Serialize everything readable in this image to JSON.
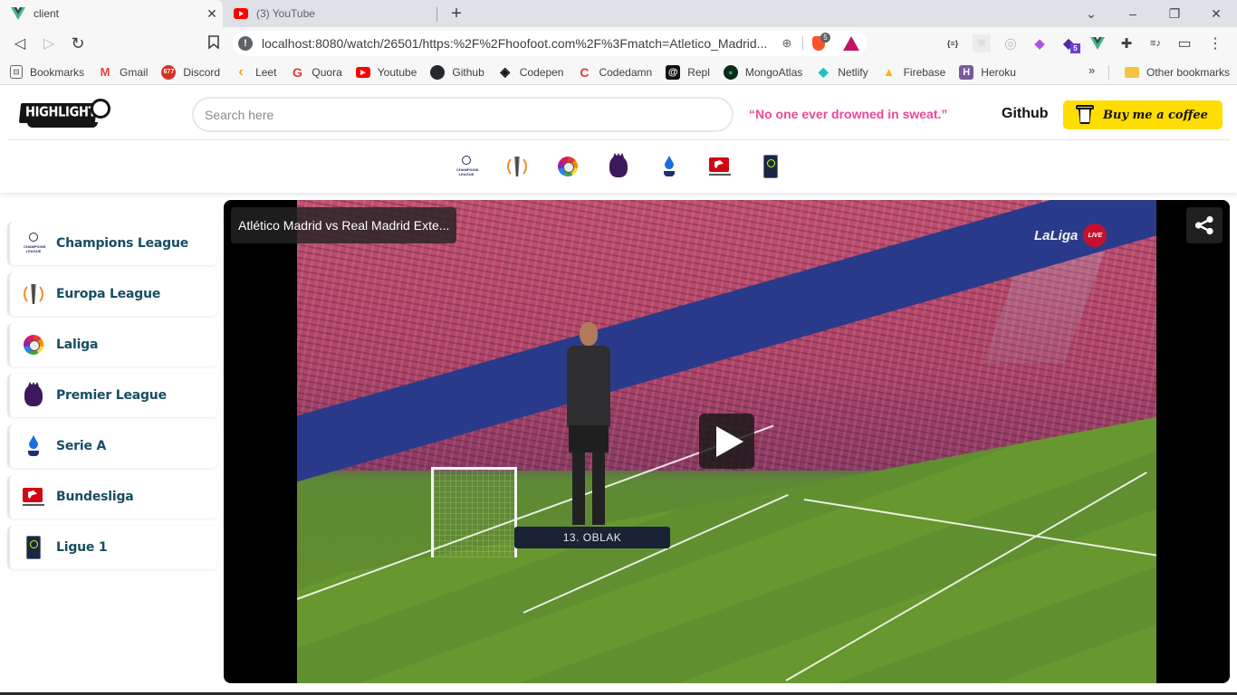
{
  "browser": {
    "tabs": [
      {
        "title": "client",
        "icon": "vue-icon",
        "active": true
      },
      {
        "title": "(3) YouTube",
        "icon": "youtube-icon",
        "active": false
      }
    ],
    "new_tab_symbol": "+",
    "window_controls": {
      "tab_search": "⌄",
      "minimize": "–",
      "restore": "❐",
      "close": "✕"
    },
    "nav": {
      "back": "◁",
      "forward": "▷",
      "reload": "↻",
      "bookmark": "⛉"
    },
    "address_bar": {
      "url": "localhost:8080/watch/26501/https:%2F%2Fhoofoot.com%2F%3Fmatch=Atletico_Madrid...",
      "site_info_icon": "!",
      "zoom_icon": "⊕",
      "brave_shields_count": "5"
    },
    "extensions": [
      {
        "name": "json-formatter-icon",
        "glyph": "{≡}"
      },
      {
        "name": "react-devtools-icon",
        "glyph": "⚛"
      },
      {
        "name": "record-icon",
        "glyph": "◎"
      },
      {
        "name": "tag-icon",
        "glyph": "◆"
      },
      {
        "name": "stack-icon",
        "glyph": "◆",
        "badge": "5"
      },
      {
        "name": "vue-devtools-icon",
        "glyph": "V"
      },
      {
        "name": "extensions-puzzle-icon",
        "glyph": "✚"
      },
      {
        "name": "media-playlist-icon",
        "glyph": "≡♪"
      },
      {
        "name": "wallet-icon",
        "glyph": "▭"
      },
      {
        "name": "menu-icon",
        "glyph": "⋮"
      }
    ],
    "bookmarks": [
      {
        "label": "Bookmarks",
        "icon": "bookmarks-icon",
        "glyph": "⊡",
        "color": "#5f6368"
      },
      {
        "label": "Gmail",
        "icon": "gmail-icon",
        "glyph": "M",
        "color": "#ea4335"
      },
      {
        "label": "Discord",
        "icon": "discord-icon",
        "glyph": "6",
        "color": "#d93025"
      },
      {
        "label": "Leet",
        "icon": "leetcode-icon",
        "glyph": "‹",
        "color": "#f89f1b"
      },
      {
        "label": "Quora",
        "icon": "quora-icon",
        "glyph": "Q",
        "color": "#b92b27"
      },
      {
        "label": "Youtube",
        "icon": "youtube-icon",
        "glyph": "▶",
        "color": "#ff0000"
      },
      {
        "label": "Github",
        "icon": "github-icon",
        "glyph": "●",
        "color": "#24292e"
      },
      {
        "label": "Codepen",
        "icon": "codepen-icon",
        "glyph": "◈",
        "color": "#111111"
      },
      {
        "label": "Codedamn",
        "icon": "codedamn-icon",
        "glyph": "C",
        "color": "#e53935"
      },
      {
        "label": "Repl",
        "icon": "repl-icon",
        "glyph": "@",
        "color": "#111111"
      },
      {
        "label": "MongoAtlas",
        "icon": "mongodb-icon",
        "glyph": "●",
        "color": "#13aa52"
      },
      {
        "label": "Netlify",
        "icon": "netlify-icon",
        "glyph": "◆",
        "color": "#20c6b7"
      },
      {
        "label": "Firebase",
        "icon": "firebase-icon",
        "glyph": "▲",
        "color": "#ffca28"
      },
      {
        "label": "Heroku",
        "icon": "heroku-icon",
        "glyph": "H",
        "color": "#79589f"
      }
    ],
    "bookmarks_overflow": "»",
    "other_bookmarks": "Other bookmarks"
  },
  "site": {
    "logo_text": "HIGHLIGHTS",
    "search": {
      "placeholder": "Search here",
      "value": ""
    },
    "quote": "“No one ever drowned in sweat.”",
    "github_label": "Github",
    "coffee_label": "Buy me a coffee",
    "colors": {
      "quote": "#ec4899",
      "coffee_bg": "#ffdd00",
      "league_text": "#164e63"
    }
  },
  "leagues": [
    {
      "name": "Champions League",
      "logo": "ucl"
    },
    {
      "name": "Europa League",
      "logo": "uel"
    },
    {
      "name": "Laliga",
      "logo": "liga"
    },
    {
      "name": "Premier League",
      "logo": "epl"
    },
    {
      "name": "Serie A",
      "logo": "seriea"
    },
    {
      "name": "Bundesliga",
      "logo": "bundes"
    },
    {
      "name": "Ligue 1",
      "logo": "ligue1"
    }
  ],
  "ucl_logo_text": "CHAMPIONS LEAGUE",
  "player": {
    "title": "Atlético Madrid vs Real Madrid Exte...",
    "overlay_caption": "13. OBLAK",
    "broadcaster_bug": "LaLiga",
    "live_badge": "LIVE",
    "share_icon": "share-icon",
    "play_icon": "play-icon"
  }
}
